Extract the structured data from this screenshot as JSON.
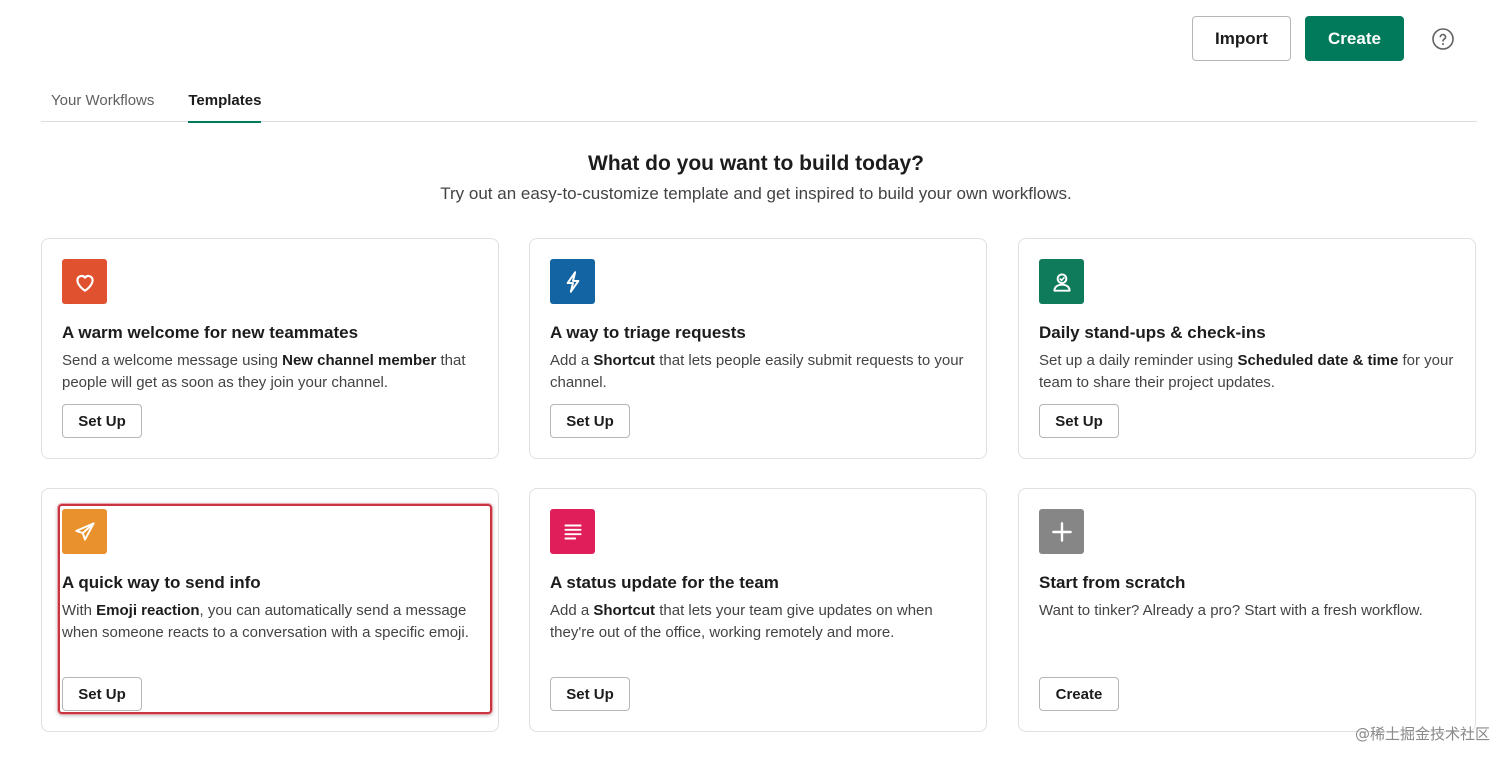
{
  "header": {
    "import_label": "Import",
    "create_label": "Create",
    "help_icon": "question-circle-icon"
  },
  "tabs": [
    {
      "label": "Your Workflows",
      "active": false
    },
    {
      "label": "Templates",
      "active": true
    }
  ],
  "hero": {
    "title": "What do you want to build today?",
    "subtitle": "Try out an easy-to-customize template and get inspired to build your own workflows."
  },
  "cards": [
    {
      "icon": "heart-icon",
      "icon_color": "#e0512f",
      "title": "A warm welcome for new teammates",
      "desc_pre": "Send a welcome message using ",
      "desc_bold": "New channel member",
      "desc_post": " that people will get as soon as they join your channel.",
      "button": "Set Up"
    },
    {
      "icon": "lightning-icon",
      "icon_color": "#1264a3",
      "title": "A way to triage requests",
      "desc_pre": "Add a ",
      "desc_bold": "Shortcut",
      "desc_post": " that lets people easily submit requests to your channel.",
      "button": "Set Up"
    },
    {
      "icon": "person-check-icon",
      "icon_color": "#0f7b5a",
      "title": "Daily stand-ups & check-ins",
      "desc_pre": "Set up a daily reminder using ",
      "desc_bold": "Scheduled date & time",
      "desc_post": " for your team to share their project updates.",
      "button": "Set Up"
    },
    {
      "icon": "paper-plane-icon",
      "icon_color": "#e8912d",
      "title": "A quick way to send info",
      "desc_pre": "With ",
      "desc_bold": "Emoji reaction",
      "desc_post": ", you can automatically send a message when someone reacts to a conversation with a specific emoji.",
      "button": "Set Up"
    },
    {
      "icon": "document-lines-icon",
      "icon_color": "#e01e5a",
      "title": "A status update for the team",
      "desc_pre": "Add a ",
      "desc_bold": "Shortcut",
      "desc_post": " that lets your team give updates on when they're out of the office, working remotely and more.",
      "button": "Set Up"
    },
    {
      "icon": "plus-icon",
      "icon_color": "#868686",
      "title": "Start from scratch",
      "desc_pre": "Want to tinker? Already a pro? Start with a fresh workflow.",
      "desc_bold": "",
      "desc_post": "",
      "button": "Create"
    }
  ],
  "watermark": "@稀土掘金技术社区"
}
